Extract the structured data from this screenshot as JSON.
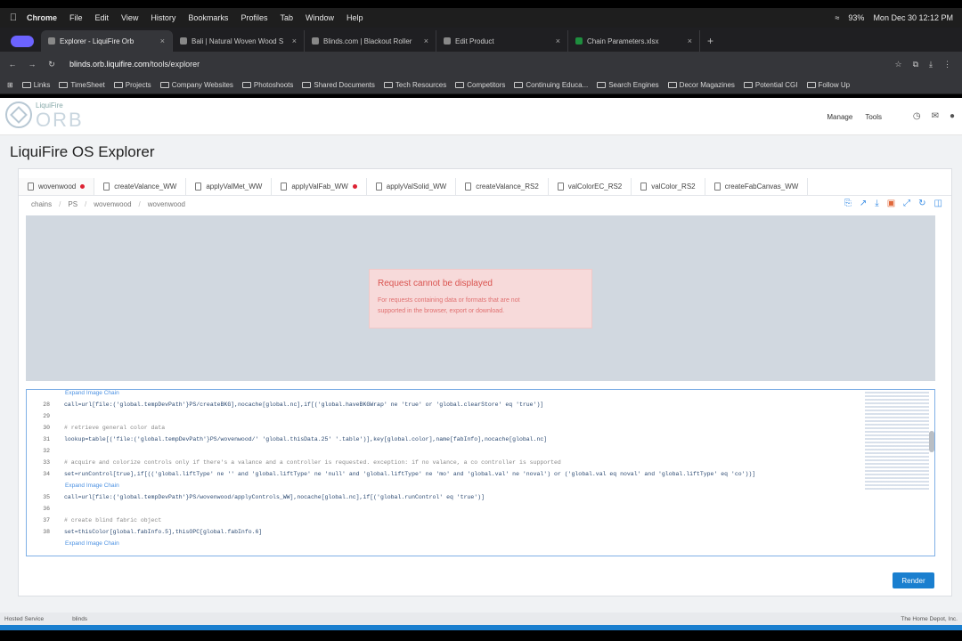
{
  "menubar": {
    "items": [
      "Chrome",
      "File",
      "Edit",
      "View",
      "History",
      "Bookmarks",
      "Profiles",
      "Tab",
      "Window",
      "Help"
    ],
    "battery": "93%",
    "datetime": "Mon Dec 30  12:12 PM"
  },
  "tabs": [
    {
      "label": "Explorer - LiquiFire Orb"
    },
    {
      "label": "Bali | Natural Woven Wood S"
    },
    {
      "label": "Blinds.com | Blackout Roller"
    },
    {
      "label": "Edit Product"
    },
    {
      "label": "Chain Parameters.xlsx"
    }
  ],
  "address": {
    "host": "blinds.orb.liquifire.com",
    "path": "/tools/explorer"
  },
  "bookmarks": [
    "Links",
    "TimeSheet",
    "Projects",
    "Company Websites",
    "Photoshoots",
    "Shared Documents",
    "Tech Resources",
    "Competitors",
    "Continuing Educa...",
    "Search Engines",
    "Decor Magazines",
    "Potential CGI",
    "Follow Up"
  ],
  "app": {
    "brand_small": "LiquiFire",
    "brand_big": "ORB",
    "nav": [
      "Manage",
      "Tools"
    ]
  },
  "page": {
    "title": "LiquiFire OS Explorer"
  },
  "file_tabs": [
    "wovenwood",
    "createValance_WW",
    "applyValMet_WW",
    "applyValFab_WW",
    "applyValSolid_WW",
    "createValance_RS2",
    "valColorEC_RS2",
    "valColor_RS2",
    "createFabCanvas_WW"
  ],
  "breadcrumb": [
    "chains",
    "PS",
    "wovenwood",
    "wovenwood"
  ],
  "error": {
    "title": "Request cannot be displayed",
    "line1": "For requests containing data or formats that are not",
    "line2": "supported in the browser, export or download."
  },
  "editor": {
    "expand_label": "Expand Image Chain",
    "lines": [
      {
        "n": "28",
        "code": "call=url[file:('global.tempDevPath'}PS/createBKG],nocache[global.nc],if[('global.haveBKGWrap' ne 'true' or 'global.clearStore' eq 'true')]"
      },
      {
        "n": "29",
        "code": ""
      },
      {
        "n": "30",
        "code": "# retrieve general color data"
      },
      {
        "n": "31",
        "code": "lookup=table[('file:('global.tempDevPath'}PS/wovenwood/'  'global.thisData.25'  '.table')],key[global.color],name[fabInfo],nocache[global.nc]"
      },
      {
        "n": "32",
        "code": ""
      },
      {
        "n": "33",
        "code": "# acquire and colorize controls only if there's a valance and a controller is requested. exception: if no valance, a co controller is supported"
      },
      {
        "n": "34",
        "code": "set=runControl[true],if[(('global.liftType' ne '' and 'global.liftType' ne 'null' and 'global.liftType' ne 'mo' and 'global.val' ne 'noval') or ('global.val eq noval' and 'global.liftType' eq 'co'))]"
      },
      {
        "n": "35",
        "code": "call=url[file:('global.tempDevPath'}PS/wovenwood/applyControls_WW],nocache[global.nc],if[('global.runControl' eq 'true')]"
      },
      {
        "n": "36",
        "code": ""
      },
      {
        "n": "37",
        "code": "# create blind fabric object"
      },
      {
        "n": "38",
        "code": "set=thisColor[global.fabInfo.5],thisOPC[global.fabInfo.6]"
      }
    ]
  },
  "render_label": "Render",
  "footer": {
    "left": "Hosted Service",
    "mid": "blinds",
    "right": "The Home Depot, Inc."
  },
  "colors": {
    "accent": "#1a7fcf",
    "error_bg": "#f7dada",
    "error_text": "#d9534f"
  }
}
